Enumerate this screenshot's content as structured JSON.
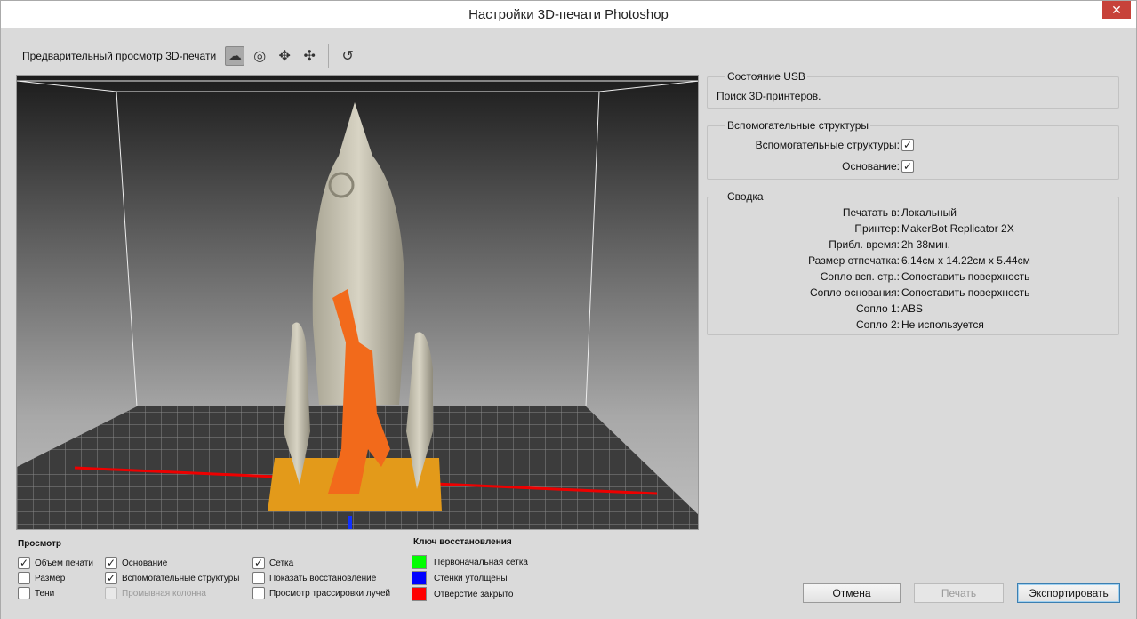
{
  "window": {
    "title": "Настройки 3D-печати Photoshop",
    "close": "✕"
  },
  "toolbar": {
    "label": "Предварительный просмотр 3D-печати",
    "tools": [
      "orbit-camera-icon",
      "rotate-icon",
      "pan-icon",
      "move-icon"
    ],
    "reset": "reset-view-icon"
  },
  "usb": {
    "title": "Состояние USB",
    "status": "Поиск 3D-принтеров."
  },
  "supports": {
    "title": "Вспомогательные структуры",
    "items": [
      {
        "label": "Вспомогательные структуры:",
        "checked": true
      },
      {
        "label": "Основание:",
        "checked": true
      }
    ]
  },
  "summary": {
    "title": "Сводка",
    "rows": [
      {
        "label": "Печатать в:",
        "value": "Локальный"
      },
      {
        "label": "Принтер:",
        "value": "MakerBot Replicator 2X"
      },
      {
        "label": "Прибл. время:",
        "value": "2h 38мин."
      },
      {
        "label": "Размер отпечатка:",
        "value": "6.14см x 14.22см x 5.44см"
      },
      {
        "label": "Сопло всп. стр.:",
        "value": "Сопоставить поверхность"
      },
      {
        "label": "Сопло основания:",
        "value": "Сопоставить поверхность"
      },
      {
        "label": "Сопло 1:",
        "value": "ABS"
      },
      {
        "label": "Сопло 2:",
        "value": "Не используется"
      }
    ]
  },
  "view": {
    "title": "Просмотр",
    "options": [
      {
        "label": "Объем печати",
        "checked": true
      },
      {
        "label": "Размер",
        "checked": false
      },
      {
        "label": "Тени",
        "checked": false
      },
      {
        "label": "Основание",
        "checked": true
      },
      {
        "label": "Вспомогательные структуры",
        "checked": true
      },
      {
        "label": "Промывная колонна",
        "checked": false,
        "disabled": true
      },
      {
        "label": "Сетка",
        "checked": true
      },
      {
        "label": "Показать восстановление",
        "checked": false
      },
      {
        "label": "Просмотр трассировки лучей",
        "checked": false
      }
    ]
  },
  "repair_key": {
    "title": "Ключ восстановления",
    "items": [
      {
        "label": "Первоначальная сетка",
        "color": "#00ff00"
      },
      {
        "label": "Стенки утолщены",
        "color": "#0000ff"
      },
      {
        "label": "Отверстие закрыто",
        "color": "#ff0000"
      }
    ]
  },
  "buttons": {
    "cancel": "Отмена",
    "print": "Печать",
    "export": "Экспортировать"
  }
}
